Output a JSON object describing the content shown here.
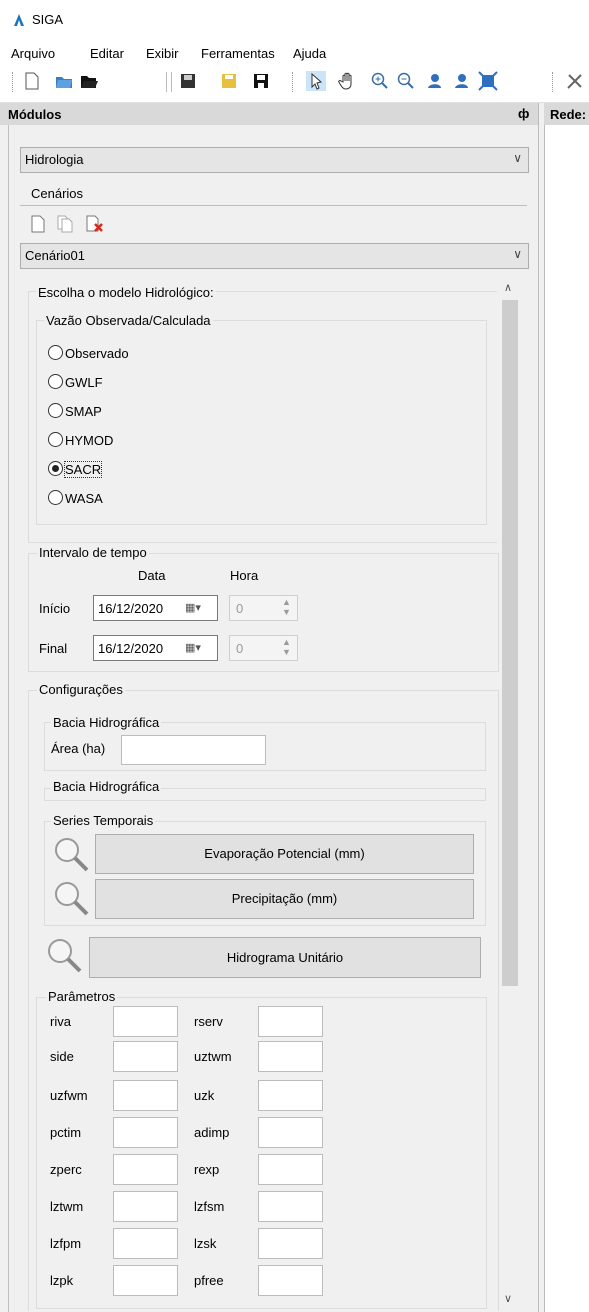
{
  "app": {
    "title": "SIGA"
  },
  "menu": [
    "Arquivo",
    "Editar",
    "Exibir",
    "Ferramentas",
    "Ajuda"
  ],
  "toolbar": {
    "icons": [
      "new-icon",
      "open-icon",
      "open-folder-icon",
      "save-icon",
      "edit-icon",
      "save-all-icon",
      "pointer-icon",
      "pan-hand-icon",
      "zoom-in-icon",
      "zoom-out-icon",
      "user-icon",
      "user-remove-icon",
      "zoom-extent-icon",
      "tools-icon"
    ]
  },
  "panel": {
    "title": "Módulos",
    "pin_glyph": "ф"
  },
  "right_panel": {
    "title": "Rede:"
  },
  "module_combo": {
    "value": "Hidrologia"
  },
  "scenarios": {
    "label": "Cenários",
    "combo_value": "Cenário01"
  },
  "model_choice": {
    "label": "Escolha o modelo Hidrológico:",
    "flow_group_label": "Vazão Observada/Calculada",
    "options": [
      {
        "label": "Observado",
        "checked": false
      },
      {
        "label": "GWLF",
        "checked": false
      },
      {
        "label": "SMAP",
        "checked": false
      },
      {
        "label": "HYMOD",
        "checked": false
      },
      {
        "label": "SACR",
        "checked": true
      },
      {
        "label": "WASA",
        "checked": false
      }
    ]
  },
  "time_interval": {
    "label": "Intervalo de tempo",
    "col_date": "Data",
    "col_hour": "Hora",
    "start_label": "Início",
    "start_date": "16/12/2020",
    "start_hour": "0",
    "end_label": "Final",
    "end_date": "16/12/2020",
    "end_hour": "0"
  },
  "config": {
    "label": "Configurações",
    "basin1_label": "Bacia Hidrográfica",
    "area_label": "Área (ha)",
    "basin2_label": "Bacia Hidrográfica",
    "series_label": "Series Temporais",
    "evap_button": "Evaporação Potencial (mm)",
    "precip_button": "Precipitação (mm)",
    "hydrogram_button": "Hidrograma Unitário"
  },
  "parameters": {
    "label": "Parâmetros",
    "left": [
      "riva",
      "side",
      "uzfwm",
      "pctim",
      "zperc",
      "lztwm",
      "lzfpm",
      "lzpk"
    ],
    "right": [
      "rserv",
      "uztwm",
      "uzk",
      "adimp",
      "rexp",
      "lzfsm",
      "lzsk",
      "pfree"
    ]
  }
}
